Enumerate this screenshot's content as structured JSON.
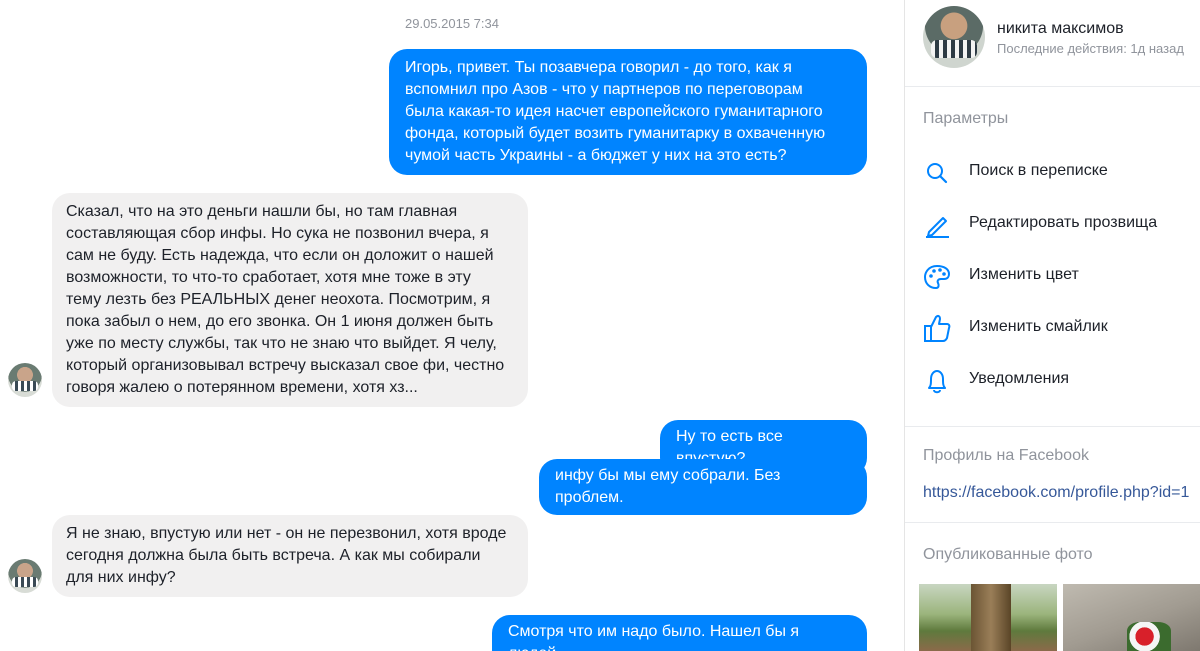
{
  "chat": {
    "timestamp": "29.05.2015 7:34",
    "messages": [
      {
        "dir": "out",
        "lines": [
          "Игорь, привет. Ты позавчера говорил - до того, как я",
          "вспомнил про Азов - что у партнеров по переговорам",
          "была какая-то идея насчет европейского гуманитарного",
          "фонда, который будет возить гуманитарку в охваченную",
          "чумой часть Украины - а бюджет у них на это есть?"
        ]
      },
      {
        "dir": "in",
        "lines": [
          "Сказал, что на это деньги нашли бы, но там главная",
          "составляющая сбор инфы. Но сука не позвонил вчера, я",
          "сам не буду. Есть надежда, что если он доложит о нашей",
          "возможности, то что-то сработает, хотя мне тоже в эту",
          "тему лезть без РЕАЛЬНЫХ денег неохота. Посмотрим, я",
          "пока забыл о нем, до его звонка. Он 1 июня должен быть",
          "уже по месту службы, так что не знаю что выйдет. Я челу,",
          "который организовывал встречу высказал свое фи, честно",
          "говоря жалею о потерянном времени, хотя хз..."
        ]
      },
      {
        "dir": "out",
        "lines": [
          "Ну то есть все впустую?"
        ]
      },
      {
        "dir": "out",
        "lines": [
          "инфу бы мы ему собрали. Без проблем."
        ]
      },
      {
        "dir": "in",
        "lines": [
          "Я не знаю, впустую или нет - он не перезвонил, хотя вроде",
          "сегодня должна была быть встреча. А как мы собирали",
          "для них инфу?"
        ]
      },
      {
        "dir": "out",
        "lines": [
          "Смотря что им надо было. Нашел бы я людей"
        ]
      }
    ]
  },
  "contact": {
    "name": "никита максимов",
    "status": "Последние действия: 1д назад"
  },
  "params": {
    "title": "Параметры",
    "items": [
      {
        "label": "Поиск в переписке",
        "icon": "search-icon"
      },
      {
        "label": "Редактировать прозвища",
        "icon": "pencil-icon"
      },
      {
        "label": "Изменить цвет",
        "icon": "palette-icon"
      },
      {
        "label": "Изменить смайлик",
        "icon": "thumbs-up-icon"
      },
      {
        "label": "Уведомления",
        "icon": "bell-icon"
      }
    ]
  },
  "facebook_profile": {
    "title": "Профиль на Facebook",
    "link": "https://facebook.com/profile.php?id=1"
  },
  "photos": {
    "title": "Опубликованные фото"
  },
  "colors": {
    "accent": "#0084ff",
    "incoming_bubble": "#f1f0f0",
    "link": "#365899",
    "muted": "#90949c"
  }
}
